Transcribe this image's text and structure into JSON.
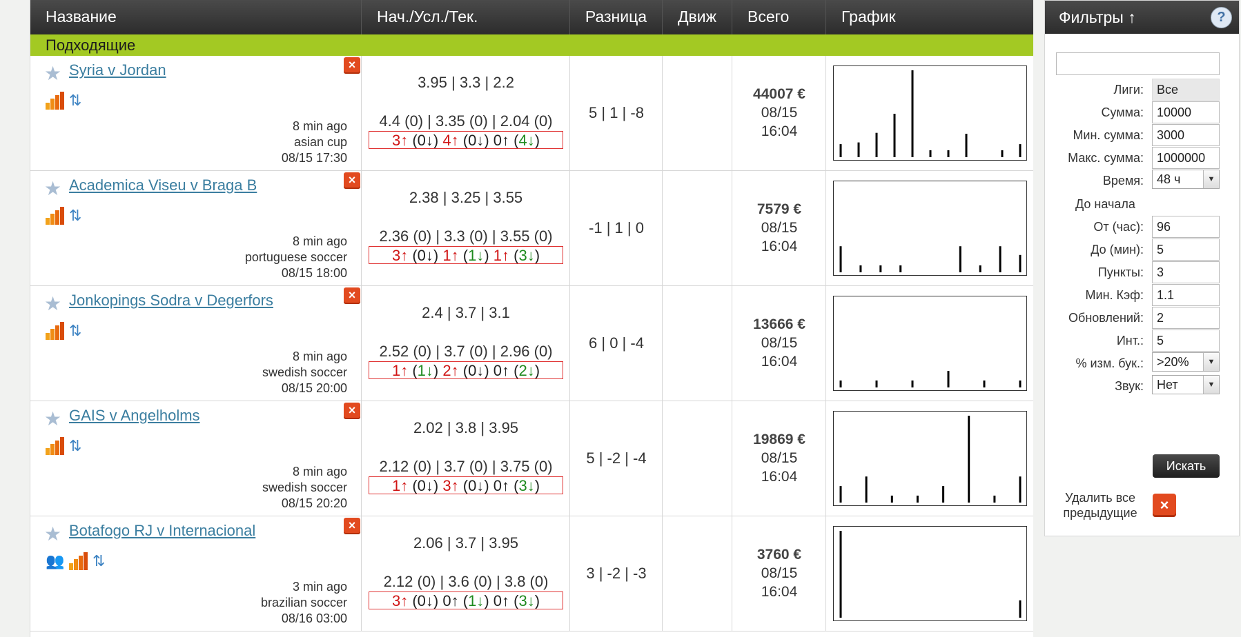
{
  "table": {
    "headers": [
      "Название",
      "Нач./Усл./Тек.",
      "Разница",
      "Движ",
      "Всего",
      "График"
    ],
    "group_label": "Подходящие",
    "rows": [
      {
        "match": "Syria v Jordan",
        "ago": "8 min ago",
        "league": "asian cup",
        "date": "08/15 17:30",
        "odds_line1": "3.95 | 3.3 | 2.2",
        "odds_line2": "4.4 (0) | 3.35 (0) | 2.04 (0)",
        "odds_line3": [
          {
            "t": "3↑",
            "c": "red"
          },
          {
            "t": " (",
            "c": "blk"
          },
          {
            "t": "0↓",
            "c": "blk"
          },
          {
            "t": ") ",
            "c": "blk"
          },
          {
            "t": "4↑",
            "c": "red"
          },
          {
            "t": " (",
            "c": "blk"
          },
          {
            "t": "0↓",
            "c": "blk"
          },
          {
            "t": ") ",
            "c": "blk"
          },
          {
            "t": "0↑",
            "c": "blk"
          },
          {
            "t": " (",
            "c": "blk"
          },
          {
            "t": "4↓",
            "c": "green"
          },
          {
            "t": ")",
            "c": "blk"
          }
        ],
        "diff": "5 | 1 | -8",
        "total": "44007 €",
        "total_date": "08/15",
        "total_time": "16:04",
        "chart": [
          15,
          17,
          28,
          50,
          100,
          8,
          8,
          27,
          0,
          8,
          15
        ],
        "has_person_icon": false
      },
      {
        "match": "Academica Viseu v Braga B",
        "ago": "8 min ago",
        "league": "portuguese soccer",
        "date": "08/15 18:00",
        "odds_line1": "2.38 | 3.25 | 3.55",
        "odds_line2": "2.36 (0) | 3.3 (0) | 3.55 (0)",
        "odds_line3": [
          {
            "t": "3↑",
            "c": "red"
          },
          {
            "t": " (",
            "c": "blk"
          },
          {
            "t": "0↓",
            "c": "blk"
          },
          {
            "t": ") ",
            "c": "blk"
          },
          {
            "t": "1↑",
            "c": "red"
          },
          {
            "t": " (",
            "c": "blk"
          },
          {
            "t": "1↓",
            "c": "green"
          },
          {
            "t": ") ",
            "c": "blk"
          },
          {
            "t": "1↑",
            "c": "red"
          },
          {
            "t": " (",
            "c": "blk"
          },
          {
            "t": "3↓",
            "c": "green"
          },
          {
            "t": ")",
            "c": "blk"
          }
        ],
        "diff": "-1 | 1 | 0",
        "total": "7579 €",
        "total_date": "08/15",
        "total_time": "16:04",
        "chart": [
          30,
          8,
          8,
          8,
          0,
          0,
          30,
          8,
          30,
          20
        ],
        "has_person_icon": false
      },
      {
        "match": "Jonkopings Sodra v Degerfors",
        "ago": "8 min ago",
        "league": "swedish soccer",
        "date": "08/15 20:00",
        "odds_line1": "2.4 | 3.7 | 3.1",
        "odds_line2": "2.52 (0) | 3.7 (0) | 2.96 (0)",
        "odds_line3": [
          {
            "t": "1↑",
            "c": "red"
          },
          {
            "t": " (",
            "c": "blk"
          },
          {
            "t": "1↓",
            "c": "green"
          },
          {
            "t": ") ",
            "c": "blk"
          },
          {
            "t": "2↑",
            "c": "red"
          },
          {
            "t": " (",
            "c": "blk"
          },
          {
            "t": "0↓",
            "c": "blk"
          },
          {
            "t": ") ",
            "c": "blk"
          },
          {
            "t": "0↑",
            "c": "blk"
          },
          {
            "t": " (",
            "c": "blk"
          },
          {
            "t": "2↓",
            "c": "green"
          },
          {
            "t": ")",
            "c": "blk"
          }
        ],
        "diff": "6 | 0 | -4",
        "total": "13666 €",
        "total_date": "08/15",
        "total_time": "16:04",
        "chart": [
          8,
          8,
          8,
          19,
          8,
          8
        ],
        "has_person_icon": false
      },
      {
        "match": "GAIS v Angelholms",
        "ago": "8 min ago",
        "league": "swedish soccer",
        "date": "08/15 20:20",
        "odds_line1": "2.02 | 3.8 | 3.95",
        "odds_line2": "2.12 (0) | 3.7 (0) | 3.75 (0)",
        "odds_line3": [
          {
            "t": "1↑",
            "c": "red"
          },
          {
            "t": " (",
            "c": "blk"
          },
          {
            "t": "0↓",
            "c": "blk"
          },
          {
            "t": ") ",
            "c": "blk"
          },
          {
            "t": "3↑",
            "c": "red"
          },
          {
            "t": " (",
            "c": "blk"
          },
          {
            "t": "0↓",
            "c": "blk"
          },
          {
            "t": ") ",
            "c": "blk"
          },
          {
            "t": "0↑",
            "c": "blk"
          },
          {
            "t": " (",
            "c": "blk"
          },
          {
            "t": "3↓",
            "c": "green"
          },
          {
            "t": ")",
            "c": "blk"
          }
        ],
        "diff": "5 | -2 | -4",
        "total": "19869 €",
        "total_date": "08/15",
        "total_time": "16:04",
        "chart": [
          19,
          30,
          8,
          8,
          19,
          100,
          8,
          30
        ],
        "has_person_icon": false
      },
      {
        "match": "Botafogo RJ v Internacional",
        "ago": "3 min ago",
        "league": "brazilian soccer",
        "date": "08/16 03:00",
        "odds_line1": "2.06 | 3.7 | 3.95",
        "odds_line2": "2.12 (0) | 3.6 (0) | 3.8 (0)",
        "odds_line3": [
          {
            "t": "3↑",
            "c": "red"
          },
          {
            "t": " (",
            "c": "blk"
          },
          {
            "t": "0↓",
            "c": "blk"
          },
          {
            "t": ") ",
            "c": "blk"
          },
          {
            "t": "0↑",
            "c": "blk"
          },
          {
            "t": " (",
            "c": "blk"
          },
          {
            "t": "1↓",
            "c": "green"
          },
          {
            "t": ") ",
            "c": "blk"
          },
          {
            "t": "0↑",
            "c": "blk"
          },
          {
            "t": " (",
            "c": "blk"
          },
          {
            "t": "3↓",
            "c": "green"
          },
          {
            "t": ")",
            "c": "blk"
          }
        ],
        "diff": "3 | -2 | -3",
        "total": "3760 €",
        "total_date": "08/15",
        "total_time": "16:04",
        "chart": [
          100,
          20
        ],
        "has_person_icon": true
      }
    ]
  },
  "filters": {
    "title": "Фильтры ↑",
    "help": "?",
    "search_value": "",
    "fields": [
      {
        "label": "Лиги:",
        "value": "Все",
        "type": "gray"
      },
      {
        "label": "Сумма:",
        "value": "10000",
        "type": "input"
      },
      {
        "label": "Мин. сумма:",
        "value": "3000",
        "type": "input"
      },
      {
        "label": "Макс. сумма:",
        "value": "1000000",
        "type": "input"
      },
      {
        "label": "Время:",
        "value": "48 ч",
        "type": "select"
      },
      {
        "label": "До начала",
        "value": "",
        "type": "label"
      },
      {
        "label": "От (час):",
        "value": "96",
        "type": "input"
      },
      {
        "label": "До (мин):",
        "value": "5",
        "type": "input"
      },
      {
        "label": "Пункты:",
        "value": "3",
        "type": "input"
      },
      {
        "label": "Мин. Кэф:",
        "value": "1.1",
        "type": "input"
      },
      {
        "label": "Обновлений:",
        "value": "2",
        "type": "input"
      },
      {
        "label": "Инт.:",
        "value": "5",
        "type": "input"
      },
      {
        "label": "% изм. бук.:",
        "value": ">20%",
        "type": "select"
      },
      {
        "label": "Звук:",
        "value": "Нет",
        "type": "select"
      }
    ],
    "search_button": "Искать",
    "delete_label": "Удалить все предыдущие",
    "delete_button": "×"
  }
}
